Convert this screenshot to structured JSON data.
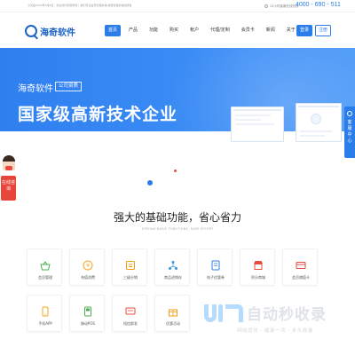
{
  "topbar": {
    "notice": "今天是2024年5月8日，欢迎访问海奇软件！我们专注会员管理系统,收银管理系统的研发",
    "slogan": "24小时客服在线热线",
    "phone": "4000 - 690 - 511"
  },
  "header": {
    "logo_text": "海奇软件",
    "nav": [
      {
        "label": "首页",
        "active": true
      },
      {
        "label": "产品",
        "active": false
      },
      {
        "label": "功能",
        "active": false
      },
      {
        "label": "购买",
        "active": false
      },
      {
        "label": "帐户",
        "active": false
      },
      {
        "label": "代理/定制",
        "active": false
      },
      {
        "label": "会员卡",
        "active": false
      },
      {
        "label": "新闻",
        "active": false
      },
      {
        "label": "关于",
        "active": false
      }
    ],
    "login_label": "登录",
    "register_label": "注册"
  },
  "hero": {
    "brand": "海奇软件",
    "tag": "公司资质",
    "headline": "国家级高新技术企业"
  },
  "side": {
    "support_label": "客服中心",
    "online_label": "在线咨询"
  },
  "features": {
    "title": "强大的基础功能，省心省力",
    "subtitle": "STRONG BASIC FUNCTIONS, SAVE EFFORT",
    "cards": [
      {
        "label": "会员管理",
        "icon": "basket-icon",
        "color": "#4caf50"
      },
      {
        "label": "充值消费",
        "icon": "coin-icon",
        "color": "#f5a623"
      },
      {
        "label": "三级分销",
        "icon": "distribution-icon",
        "color": "#f39c12"
      },
      {
        "label": "商品进销存",
        "icon": "network-icon",
        "color": "#3498db"
      },
      {
        "label": "电子优惠券",
        "icon": "coupon-icon",
        "color": "#2b7de9"
      },
      {
        "label": "积分商城",
        "icon": "store-icon",
        "color": "#e74c3c"
      },
      {
        "label": "会员储值卡",
        "icon": "card-icon",
        "color": "#e84a3c"
      },
      {
        "label": "手机APP",
        "icon": "phone-icon",
        "color": "#f5a623"
      },
      {
        "label": "移动POS",
        "icon": "pos-icon",
        "color": "#4caf50"
      },
      {
        "label": "短信群发",
        "icon": "sms-icon",
        "color": "#e74c3c"
      },
      {
        "label": "优惠活动",
        "icon": "gift-icon",
        "color": "#f39c12"
      }
    ]
  },
  "watermark": {
    "title": "自动秒收录",
    "subtitle": "网站优化 · 收录一次 · 永久收录"
  }
}
